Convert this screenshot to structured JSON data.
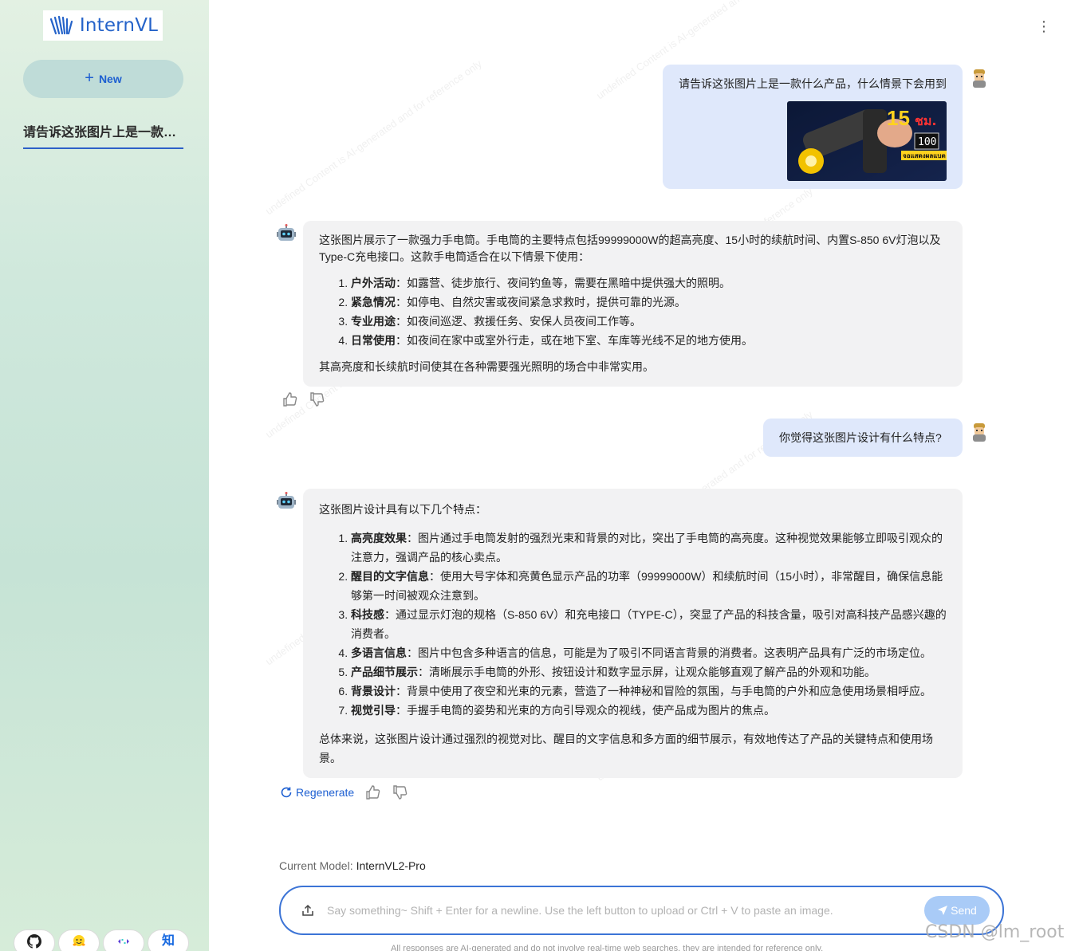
{
  "sidebar": {
    "logo_text": "InternVL",
    "new_label": "New",
    "history": [
      "请告诉这张图片上是一款什么产品，什么情景下会用到"
    ],
    "footer_icons": [
      "github-icon",
      "huggingface-icon",
      "modelscope-icon",
      "zhihu-icon"
    ],
    "zhihu_char": "知"
  },
  "chat": {
    "messages": [
      {
        "role": "user",
        "text": "请告诉这张图片上是一款什么产品，什么情景下会用到",
        "image": {
          "big_number": "15",
          "unit": "ชม.",
          "display_value": "100",
          "banner": "จอแสดงผลแบต"
        }
      },
      {
        "role": "assistant",
        "intro": "这张图片展示了一款强力手电筒。手电筒的主要特点包括99999000W的超高亮度、15小时的续航时间、内置S-850 6V灯泡以及Type-C充电接口。这款手电筒适合在以下情景下使用：",
        "items": [
          {
            "title": "户外活动",
            "text": "：如露营、徒步旅行、夜间钓鱼等，需要在黑暗中提供强大的照明。"
          },
          {
            "title": "紧急情况",
            "text": "：如停电、自然灾害或夜间紧急求救时，提供可靠的光源。"
          },
          {
            "title": "专业用途",
            "text": "：如夜间巡逻、救援任务、安保人员夜间工作等。"
          },
          {
            "title": "日常使用",
            "text": "：如夜间在家中或室外行走，或在地下室、车库等光线不足的地方使用。"
          }
        ],
        "outro": "其高亮度和长续航时间使其在各种需要强光照明的场合中非常实用。"
      },
      {
        "role": "user",
        "text": "你觉得这张图片设计有什么特点?"
      },
      {
        "role": "assistant",
        "intro": "这张图片设计具有以下几个特点：",
        "items": [
          {
            "title": "高亮度效果",
            "text": "：图片通过手电筒发射的强烈光束和背景的对比，突出了手电筒的高亮度。这种视觉效果能够立即吸引观众的注意力，强调产品的核心卖点。"
          },
          {
            "title": "醒目的文字信息",
            "text": "：使用大号字体和亮黄色显示产品的功率（99999000W）和续航时间（15小时），非常醒目，确保信息能够第一时间被观众注意到。"
          },
          {
            "title": "科技感",
            "text": "：通过显示灯泡的规格（S-850 6V）和充电接口（TYPE-C），突显了产品的科技含量，吸引对高科技产品感兴趣的消费者。"
          },
          {
            "title": "多语言信息",
            "text": "：图片中包含多种语言的信息，可能是为了吸引不同语言背景的消费者。这表明产品具有广泛的市场定位。"
          },
          {
            "title": "产品细节展示",
            "text": "：清晰展示手电筒的外形、按钮设计和数字显示屏，让观众能够直观了解产品的外观和功能。"
          },
          {
            "title": "背景设计",
            "text": "：背景中使用了夜空和光束的元素，营造了一种神秘和冒险的氛围，与手电筒的户外和应急使用场景相呼应。"
          },
          {
            "title": "视觉引导",
            "text": "：手握手电筒的姿势和光束的方向引导观众的视线，使产品成为图片的焦点。"
          }
        ],
        "outro": "总体来说，这张图片设计通过强烈的视觉对比、醒目的文字信息和多方面的细节展示，有效地传达了产品的关键特点和使用场景。"
      }
    ],
    "regenerate_label": "Regenerate"
  },
  "model": {
    "label": "Current Model:",
    "value": "InternVL2-Pro"
  },
  "input": {
    "placeholder": "Say something~ Shift + Enter for a newline. Use the left button to upload or Ctrl + V to paste an image.",
    "value": "",
    "send_label": "Send"
  },
  "disclaimer": "All responses are AI-generated and do not involve real-time web searches, they are intended for reference only.",
  "watermark": "undefined Content is AI-generated and for reference only",
  "corner_watermark": "CSDN @lm_root",
  "colors": {
    "accent": "#2563c9",
    "user_bubble": "#dfe8fb",
    "bot_bubble": "#f2f2f3",
    "send_button": "#a9cbf7"
  }
}
